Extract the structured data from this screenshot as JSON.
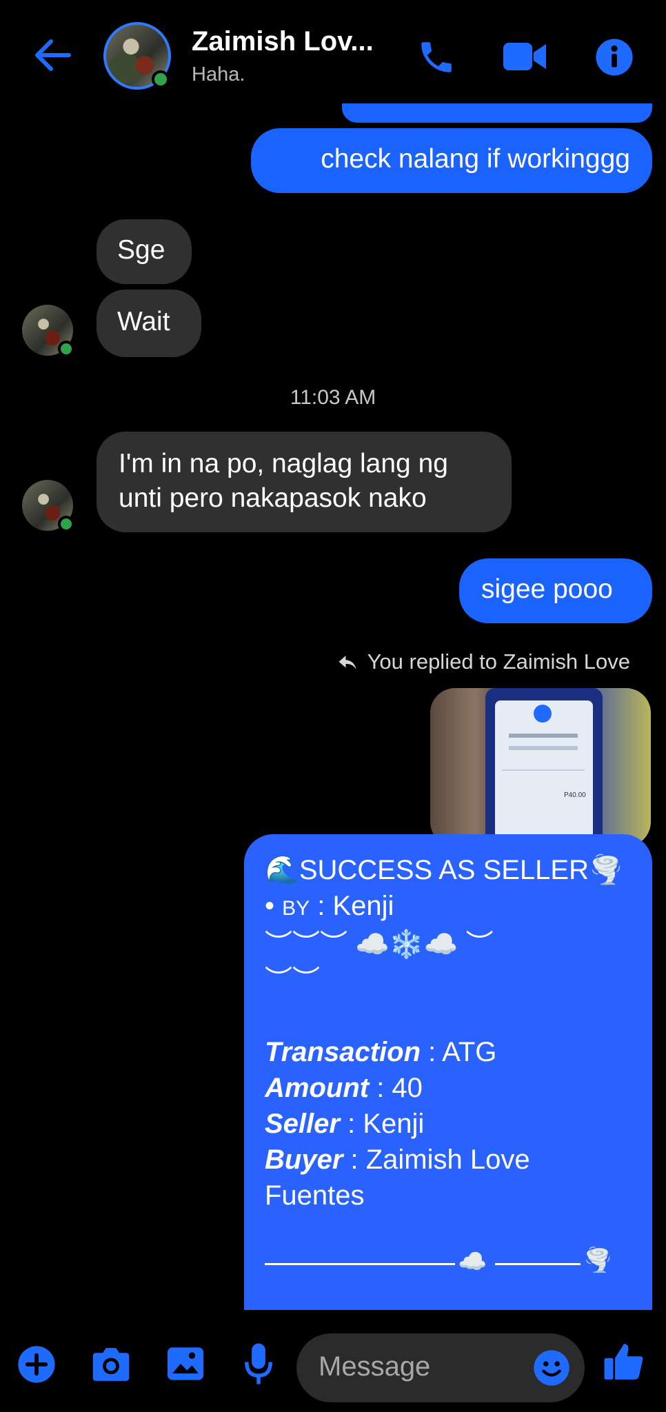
{
  "header": {
    "contact_name": "Zaimish Lov...",
    "status": "Haha.",
    "accent": "#1f6bff"
  },
  "messages": [
    {
      "from": "me",
      "text": "check nalang if workinggg"
    },
    {
      "from": "them",
      "text": "Sge"
    },
    {
      "from": "them",
      "text": "Wait"
    },
    {
      "from": "them",
      "text_line1": "I'm in na po, naglag lang ng",
      "text_line2": "unti pero nakapasok nako"
    },
    {
      "from": "me",
      "text": "sigee pooo"
    }
  ],
  "timestamp": "11:03 AM",
  "reply_note": "You replied to Zaimish Love",
  "photo_amount": "P40.00",
  "card": {
    "title": "SUCCESS AS SELLER",
    "by_label": "BY",
    "by_value": "Kenji",
    "deco_line1": "︶︶︶ ☁️❄️☁️ ︶",
    "deco_line2": "︶︶",
    "transaction_label": "Transaction",
    "transaction_value": "ATG",
    "amount_label": "Amount",
    "amount_value": "40",
    "seller_label": "Seller",
    "seller_value": "Kenji",
    "buyer_label": "Buyer",
    "buyer_value_line1": "Zaimish Love",
    "buyer_value_line2": "Fuentes"
  },
  "composer": {
    "placeholder": "Message"
  }
}
